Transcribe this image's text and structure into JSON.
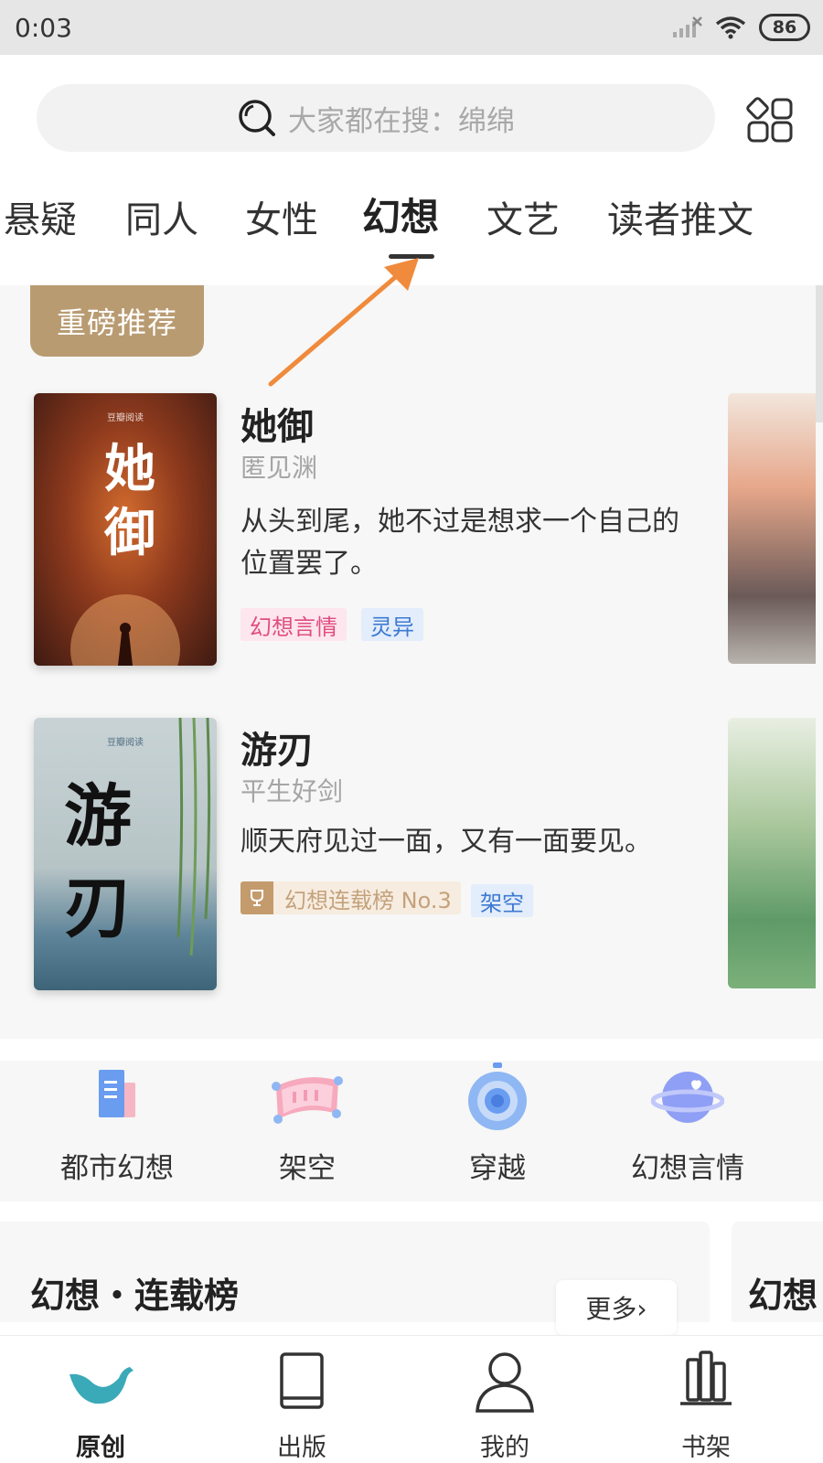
{
  "status_bar": {
    "time": "0:03",
    "battery": "86"
  },
  "search": {
    "placeholder": "大家都在搜：绵绵"
  },
  "tabs": [
    {
      "label": "悬疑"
    },
    {
      "label": "同人"
    },
    {
      "label": "女性"
    },
    {
      "label": "幻想"
    },
    {
      "label": "文艺"
    },
    {
      "label": "读者推文"
    }
  ],
  "active_tab": "幻想",
  "featured": {
    "badge": "重磅推荐",
    "books": [
      {
        "title": "她御",
        "author": "匿见渊",
        "description": "从头到尾，她不过是想求一个自己的位置罢了。",
        "cover_title": "她御",
        "cover_brand": "豆瓣阅读",
        "tags": [
          "幻想言情",
          "灵异"
        ]
      },
      {
        "title": "游刃",
        "author": "平生好剑",
        "description": "顺天府见过一面，又有一面要见。",
        "cover_title": "游刃",
        "cover_brand": "豆瓣阅读",
        "rank_tag": "幻想连载榜 No.3",
        "tags": [
          "架空"
        ]
      }
    ]
  },
  "categories": [
    {
      "label": "都市幻想",
      "icon": "book-stack-icon"
    },
    {
      "label": "架空",
      "icon": "scroll-icon"
    },
    {
      "label": "穿越",
      "icon": "clock-portal-icon"
    },
    {
      "label": "幻想言情",
      "icon": "planet-icon"
    }
  ],
  "ranking": {
    "title": "幻想・连载榜",
    "more": "更多›",
    "peek_title": "幻想"
  },
  "bottom_nav": [
    {
      "label": "原创",
      "icon": "bird-icon"
    },
    {
      "label": "出版",
      "icon": "book-icon"
    },
    {
      "label": "我的",
      "icon": "person-icon"
    },
    {
      "label": "书架",
      "icon": "bookshelf-icon"
    }
  ],
  "colors": {
    "accent_brown": "#b99b72",
    "bird_teal": "#3aa9b8",
    "annotation_arrow": "#f08a3c",
    "tag_pink": "#e04d80",
    "tag_blue": "#3e7ad2"
  }
}
